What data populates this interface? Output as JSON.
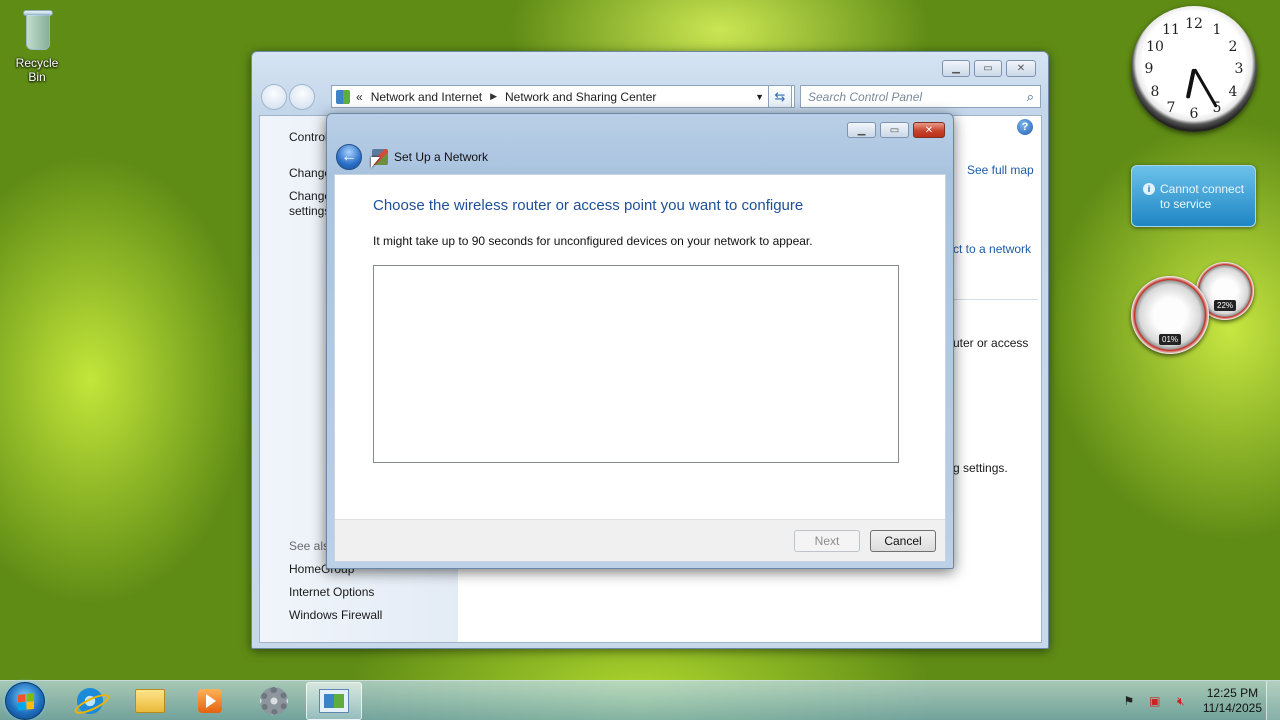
{
  "desktop": {
    "icons": [
      {
        "label": "Recycle Bin",
        "icon": "recycle-bin-icon"
      }
    ]
  },
  "gadgets": {
    "clock": {
      "numbers": [
        "12",
        "1",
        "2",
        "3",
        "4",
        "5",
        "6",
        "7",
        "8",
        "9",
        "10",
        "11"
      ],
      "time": "12:25"
    },
    "weather": {
      "message": "Cannot connect to service"
    },
    "meter": {
      "cpu": "01%",
      "memory": "22%"
    }
  },
  "window": {
    "address": {
      "overflow": "«",
      "crumbs": [
        "Network and Internet",
        "Network and Sharing Center"
      ]
    },
    "search": {
      "placeholder": "Search Control Panel"
    },
    "left_pane": {
      "control_panel_home": "Control",
      "change_adapter": "Change",
      "change_advanced_1": "Change",
      "change_advanced_2": "settings",
      "see_also": "See also",
      "links": [
        "HomeGroup",
        "Internet Options",
        "Windows Firewall"
      ]
    },
    "right": {
      "see_full_map": "See full map",
      "connect_to_network": "ct to a network",
      "router_text": "uter or access",
      "settings_text": "g settings."
    }
  },
  "dialog": {
    "title": "Set Up a Network",
    "heading": "Choose the wireless router or access point you want to configure",
    "description": "It might take up to 90 seconds for unconfigured devices on your network to appear.",
    "devices": [],
    "buttons": {
      "next": "Next",
      "cancel": "Cancel"
    }
  },
  "taskbar": {
    "pinned": [
      "internet-explorer-icon",
      "windows-explorer-icon",
      "media-player-icon",
      "settings-gear-icon",
      "control-panel-icon"
    ],
    "active": "control-panel-icon",
    "tray": {
      "time": "12:25 PM",
      "date": "11/14/2025"
    }
  }
}
